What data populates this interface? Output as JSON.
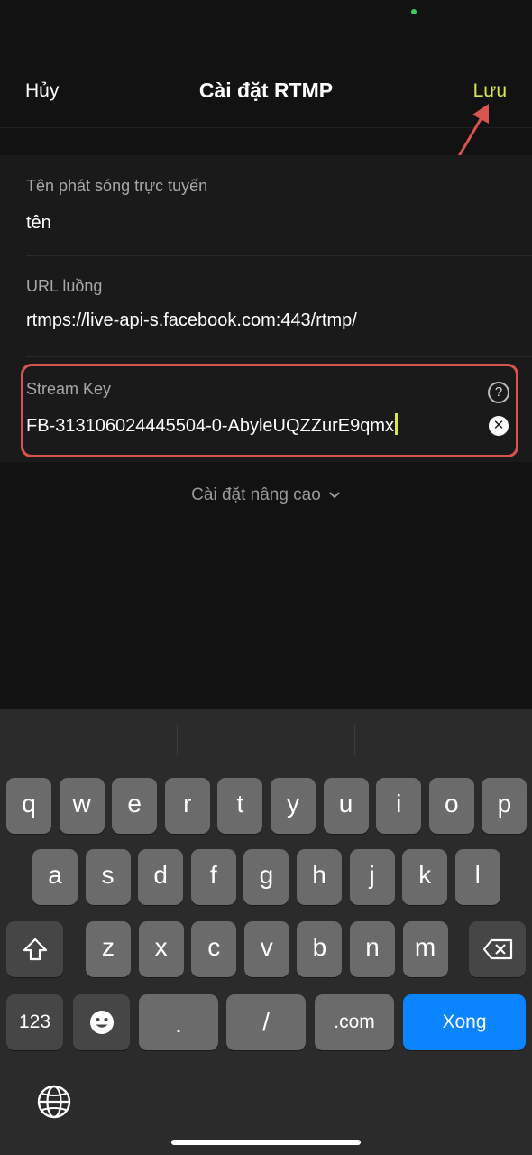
{
  "header": {
    "cancel": "Hủy",
    "title": "Cài đặt RTMP",
    "save": "Lưu"
  },
  "form": {
    "name_label": "Tên phát sóng trực tuyến",
    "name_value": "tên",
    "url_label": "URL luồng",
    "url_value": "rtmps://live-api-s.facebook.com:443/rtmp/",
    "key_label": "Stream Key",
    "key_value": "FB-313106024445504-0-AbyleUQZZurE9qmx"
  },
  "advanced": {
    "label": "Cài đặt nâng cao"
  },
  "keyboard": {
    "row1": [
      "q",
      "w",
      "e",
      "r",
      "t",
      "y",
      "u",
      "i",
      "o",
      "p"
    ],
    "row2": [
      "a",
      "s",
      "d",
      "f",
      "g",
      "h",
      "j",
      "k",
      "l"
    ],
    "row3": [
      "z",
      "x",
      "c",
      "v",
      "b",
      "n",
      "m"
    ],
    "numbers": "123",
    "period": ".",
    "slash": "/",
    "dotcom": ".com",
    "done": "Xong"
  },
  "colors": {
    "accent": "#d7e64b",
    "highlight_border": "#d9534f",
    "done_key": "#0a84ff"
  }
}
